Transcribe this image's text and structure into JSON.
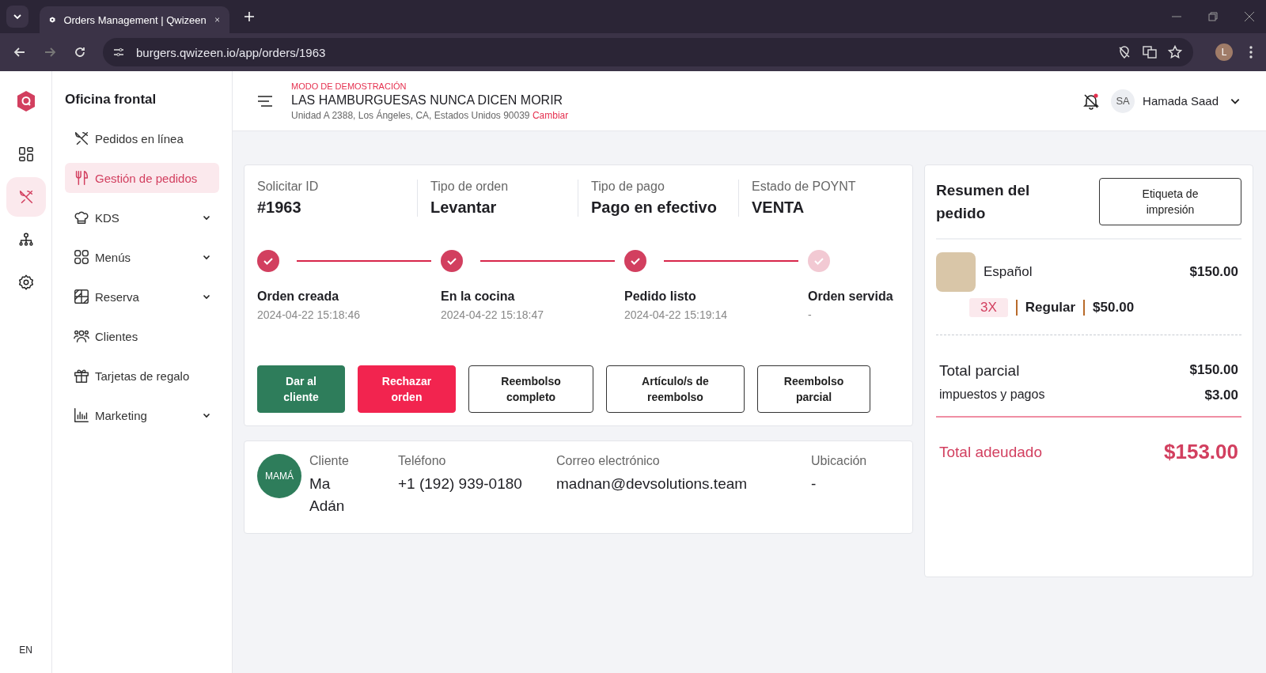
{
  "browser": {
    "tab_title": "Orders Management | Qwizeen",
    "url": "burgers.qwizeen.io/app/orders/1963",
    "profile_initial": "L"
  },
  "rail": {
    "items": [
      {
        "selected": false
      },
      {
        "selected": true
      },
      {
        "selected": false
      },
      {
        "selected": false
      }
    ],
    "language": "EN"
  },
  "sidebar": {
    "title": "Oficina frontal",
    "items": [
      {
        "label": "Pedidos en línea",
        "selected": false,
        "expandable": false
      },
      {
        "label": "Gestión de pedidos",
        "selected": true,
        "expandable": false
      },
      {
        "label": "KDS",
        "selected": false,
        "expandable": true
      },
      {
        "label": "Menús",
        "selected": false,
        "expandable": true
      },
      {
        "label": "Reserva",
        "selected": false,
        "expandable": true
      },
      {
        "label": "Clientes",
        "selected": false,
        "expandable": false
      },
      {
        "label": "Tarjetas de regalo",
        "selected": false,
        "expandable": false
      },
      {
        "label": "Marketing",
        "selected": false,
        "expandable": true
      }
    ]
  },
  "header": {
    "mode_label": "MODO DE DEMOSTRACIÓN",
    "restaurant": "LAS HAMBURGUESAS NUNCA DICEN MORIR",
    "address": "Unidad A 2388, Los Ángeles, CA, Estados Unidos 90039",
    "change_link": "Cambiar",
    "user_initials": "SA",
    "user_name": "Hamada Saad"
  },
  "order": {
    "fields": [
      {
        "label": "Solicitar ID",
        "value": "#1963"
      },
      {
        "label": "Tipo de orden",
        "value": "Levantar"
      },
      {
        "label": "Tipo de pago",
        "value": "Pago en efectivo"
      },
      {
        "label": "Estado de POYNT",
        "value": "VENTA"
      }
    ],
    "steps": [
      {
        "label": "Orden creada",
        "time": "2024-04-22 15:18:46",
        "done": true
      },
      {
        "label": "En la cocina",
        "time": "2024-04-22 15:18:47",
        "done": true
      },
      {
        "label": "Pedido listo",
        "time": "2024-04-22 15:19:14",
        "done": true
      },
      {
        "label": "Orden servida",
        "time": "-",
        "done": false
      }
    ],
    "actions": [
      {
        "label": "Dar al cliente",
        "kind": "success"
      },
      {
        "label": "Rechazar orden",
        "kind": "danger"
      },
      {
        "label": "Reembolso completo",
        "kind": "outline"
      },
      {
        "label": "Artículo/s de reembolso",
        "kind": "outline"
      },
      {
        "label": "Reembolso parcial",
        "kind": "outline"
      }
    ]
  },
  "customer": {
    "avatar": "MAMÁ",
    "fields": [
      {
        "label": "Cliente",
        "value": "Ma Adán"
      },
      {
        "label": "Teléfono",
        "value": "+1 (192) 939-0180"
      },
      {
        "label": "Correo electrónico",
        "value": "madnan@devsolutions.team"
      },
      {
        "label": "Ubicación",
        "value": "-"
      }
    ]
  },
  "summary": {
    "title": "Resumen del pedido",
    "print_button": "Etiqueta de impresión",
    "items": [
      {
        "name": "Español",
        "price": "$150.00",
        "quantity": "3X",
        "variant": "Regular",
        "unit_price": "$50.00"
      }
    ],
    "rows": [
      {
        "label": "Total parcial",
        "value": "$150.00"
      },
      {
        "label": "impuestos y pagos",
        "value": "$3.00"
      }
    ],
    "total_label": "Total adeudado",
    "total_value": "$153.00"
  }
}
